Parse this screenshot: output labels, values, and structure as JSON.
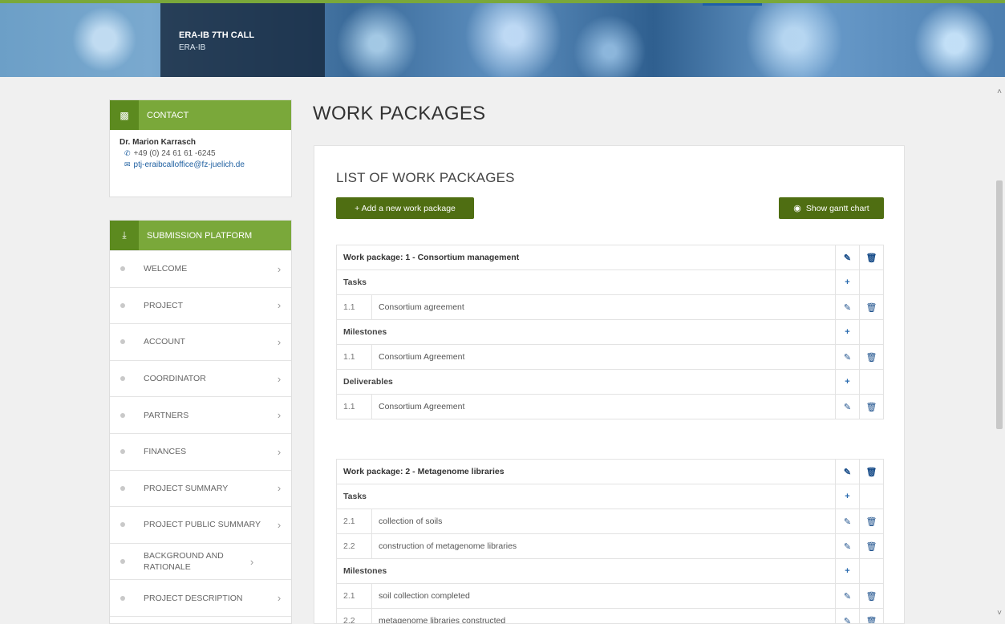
{
  "header": {
    "title": "ERA-IB 7TH CALL",
    "subtitle": "ERA-IB"
  },
  "contact": {
    "heading": "CONTACT",
    "name": "Dr. Marion Karrasch",
    "phone": "+49 (0) 24 61 61 -6245",
    "email": "ptj-eraibcalloffice@fz-juelich.de"
  },
  "platform": {
    "heading": "SUBMISSION PLATFORM",
    "items": [
      "WELCOME",
      "PROJECT",
      "ACCOUNT",
      "COORDINATOR",
      "PARTNERS",
      "FINANCES",
      "PROJECT SUMMARY",
      "PROJECT PUBLIC SUMMARY",
      "BACKGROUND AND RATIONALE",
      "PROJECT DESCRIPTION"
    ]
  },
  "main": {
    "page_title": "WORK PACKAGES",
    "list_title": "LIST OF WORK PACKAGES",
    "add_button": "+ Add a new work package",
    "gantt_button": "Show gantt chart"
  },
  "labels": {
    "tasks": "Tasks",
    "milestones": "Milestones",
    "deliverables": "Deliverables"
  },
  "wp1": {
    "title": "Work package: 1 - Consortium management",
    "tasks": [
      {
        "num": "1.1",
        "name": "Consortium agreement"
      }
    ],
    "milestones": [
      {
        "num": "1.1",
        "name": "Consortium Agreement"
      }
    ],
    "deliverables": [
      {
        "num": "1.1",
        "name": "Consortium Agreement"
      }
    ]
  },
  "wp2": {
    "title": "Work package: 2 - Metagenome libraries",
    "tasks": [
      {
        "num": "2.1",
        "name": "collection of soils"
      },
      {
        "num": "2.2",
        "name": "construction of metagenome libraries"
      }
    ],
    "milestones": [
      {
        "num": "2.1",
        "name": "soil collection completed"
      },
      {
        "num": "2.2",
        "name": "metagenome libraries constructed"
      }
    ]
  },
  "icons": {
    "edit": "pencil-icon",
    "delete": "trash-icon",
    "add": "plus-icon"
  },
  "colors": {
    "accent": "#7aa83a",
    "button": "#4f6e12",
    "link": "#1e5fa0"
  }
}
